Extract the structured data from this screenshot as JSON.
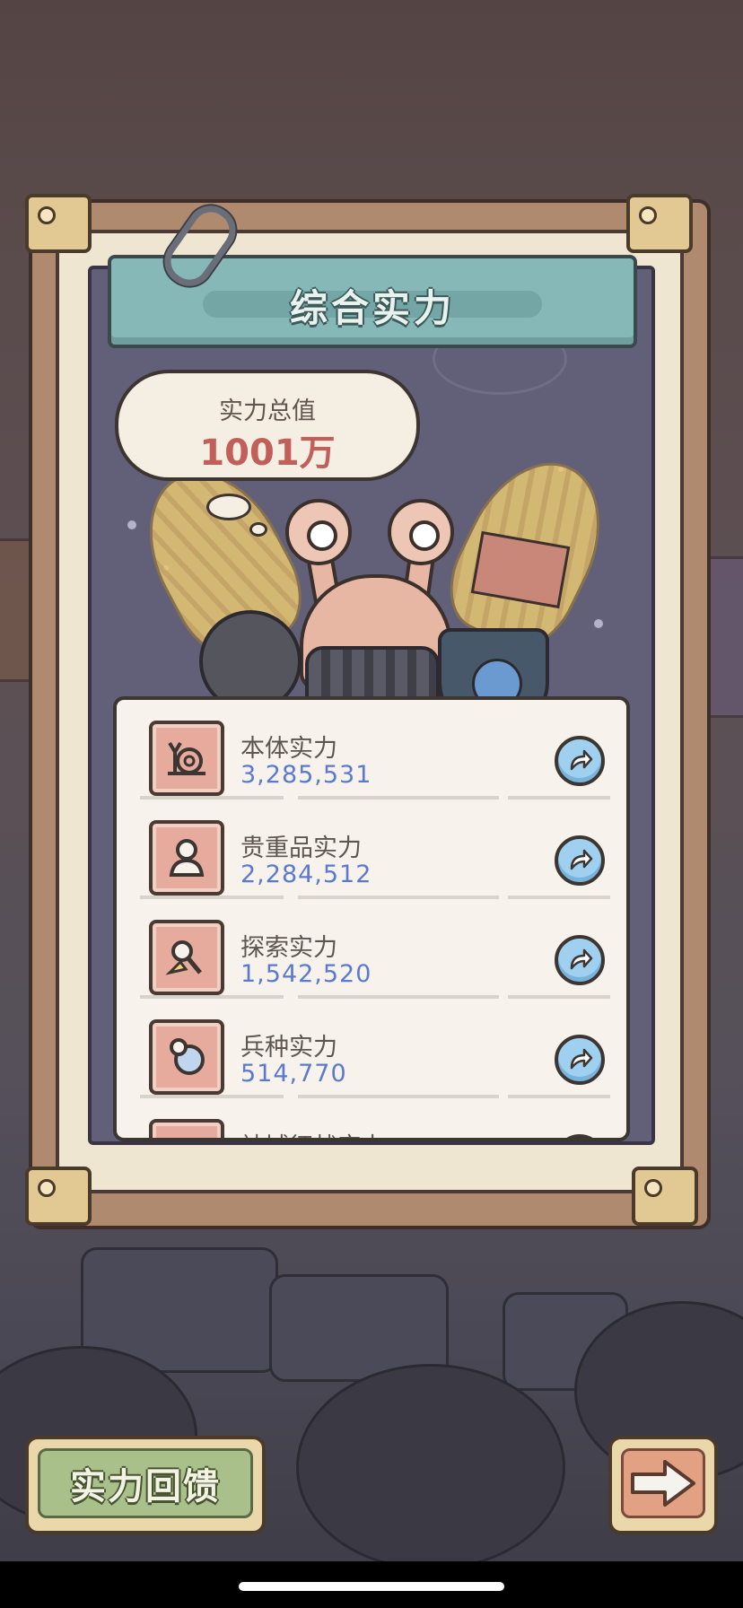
{
  "header": {
    "title": "综合实力"
  },
  "summary": {
    "label": "实力总值",
    "value": "1001万"
  },
  "stats": [
    {
      "label": "本体实力",
      "value": "3,285,531",
      "icon": "snail-icon"
    },
    {
      "label": "贵重品实力",
      "value": "2,284,512",
      "icon": "statue-bust-icon"
    },
    {
      "label": "探索实力",
      "value": "1,542,520",
      "icon": "magnifier-broom-icon"
    },
    {
      "label": "兵种实力",
      "value": "514,770",
      "icon": "pacifier-icon"
    },
    {
      "label": "神域征战实力",
      "value": "",
      "icon": "partially-hidden-icon"
    }
  ],
  "buttons": {
    "feedback_label": "实力回馈",
    "next_icon": "arrow-right-icon"
  },
  "colors": {
    "value_text": "#5b79cf",
    "total_value": "#c15f5a",
    "header_plaque": "#86b8b7",
    "feedback_button": "#a9c08a",
    "next_button": "#e3a184",
    "row_button": "#9fd0ef"
  }
}
